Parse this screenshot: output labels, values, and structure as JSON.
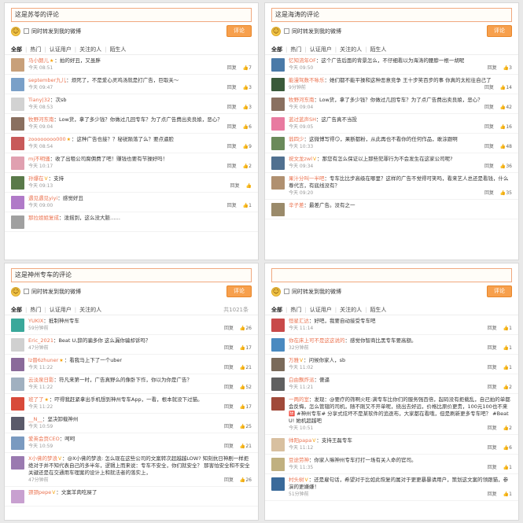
{
  "panels": [
    {
      "input": "这是苏苓的评论",
      "also_forward": "同时转发到我的微博",
      "submit": "评论",
      "tabs": [
        "全部",
        "热门",
        "认证用户",
        "关注的人",
        "陌生人"
      ],
      "total": "",
      "comments": [
        {
          "user": "马小朗儿",
          "badge": "★",
          "text": "拍的好丑，又虽胖",
          "time": "今天 08:51",
          "reply": "回复",
          "likes": "7",
          "avatar": "#c8a07a"
        },
        {
          "user": "september九儿",
          "badge": "",
          "text": "烦死了，不是爱心灵鸡汤就是打广告，巨取关～",
          "time": "今天 09:47",
          "reply": "回复",
          "likes": "3",
          "avatar": "#7aa0c8"
        },
        {
          "user": "Tiany|32",
          "badge": "",
          "text": "次sb",
          "time": "今天 08:53",
          "reply": "回复",
          "likes": "3",
          "avatar": "#d2d2d2"
        },
        {
          "user": "牧野河东南",
          "badge": "",
          "text": "Low货，拿了多少钱？你做过几回专车？为了点广告费出卖良娘，恶心？",
          "time": "今天 09:04",
          "reply": "回复",
          "likes": "6",
          "avatar": "#8a7060"
        },
        {
          "user": "zoooooooo000",
          "badge": "★",
          "text": "这种广告也接？？秘锐陨落了么？要点逼脸",
          "time": "今天 08:54",
          "reply": "回复",
          "likes": "9",
          "avatar": "#c85a5a"
        },
        {
          "user": "mj不明骚",
          "badge": "",
          "text": "收了出租公司腐佣费了吧！赚钱也要有节操好吗！",
          "time": "今天 10:17",
          "reply": "回复",
          "likes": "2",
          "avatar": "#e0a0b0"
        },
        {
          "user": "孙爆在",
          "badge": "V",
          "text": "支持",
          "time": "今天 09:13",
          "reply": "回复",
          "likes": "",
          "avatar": "#5a7a4a"
        },
        {
          "user": "遇见遇见yiyi",
          "badge": "",
          "text": "感觉好丑",
          "time": "今天 09:00",
          "reply": "回复",
          "likes": "1",
          "avatar": "#b07ac8"
        },
        {
          "user": "那拉姐姐复成",
          "badge": "",
          "text": "泼摇到，这么没大脓……",
          "time": "",
          "reply": "",
          "likes": "",
          "avatar": "#a0a0a0"
        }
      ]
    },
    {
      "input": "这是海涛的评论",
      "also_forward": "同时转发到我的微博",
      "submit": "评论",
      "tabs": [
        "全部",
        "热门",
        "认证用户",
        "关注的人",
        "陌生人"
      ],
      "total": "",
      "comments": [
        {
          "user": "忆知流年OF",
          "badge": "",
          "text": "这个广告后面的背景怎么，不仔细看以为海涛的腰脖一根一胡呢",
          "time": "今天 09:50",
          "reply": "回复",
          "likes": "3",
          "avatar": "#4a7aa8"
        },
        {
          "user": "能漫驾数不咏乐",
          "badge": "",
          "text": "她们都不能平操和这种恶意竞争 王十步笑百步的事 你真的太松往自己了",
          "time": "9分钟前",
          "reply": "回复",
          "likes": "14",
          "avatar": "#3a5a3a"
        },
        {
          "user": "牧野河东南",
          "badge": "",
          "text": "Low货，拿了多少钱？你做过几回专车？为了点广告费出卖良娘，恶心？",
          "time": "今天 09:04",
          "reply": "回复",
          "likes": "42",
          "avatar": "#8a7060"
        },
        {
          "user": "蓝过蓝声SH",
          "badge": "",
          "text": "这广告真不当投",
          "time": "今天 09:05",
          "reply": "回复",
          "likes": "16",
          "avatar": "#e87aa0"
        },
        {
          "user": "翁四少",
          "badge": "",
          "text": "这微博写得😏，果断都粉，从此再也不看你的任何作品，敢涂跟啊",
          "time": "今天 10:33",
          "reply": "回复",
          "likes": "48",
          "avatar": "#6a8a5a"
        },
        {
          "user": "祝文龙zwl",
          "badge": "V",
          "text": "那您有怎么保证以上那些犯罪行为不会发生在这家公司呢?",
          "time": "今天 09:34",
          "reply": "回复",
          "likes": "36",
          "avatar": "#507090"
        },
        {
          "user": "果汁分叫一半吧",
          "badge": "",
          "text": "专车比比步高级在哪里？这样的广告不觉得可笑吗，看来艺人总还是看钱，什么尊代言，有底线没有？",
          "time": "今天 09:20",
          "reply": "回复",
          "likes": "35",
          "avatar": "#b09070"
        },
        {
          "user": "辛子差",
          "badge": "",
          "text": "最差广告。没有之一",
          "time": "",
          "reply": "",
          "likes": "",
          "avatar": "#9a8a6a"
        }
      ]
    },
    {
      "input": "这是神州专车的评论",
      "also_forward": "同时转发到我的微博",
      "submit": "评论",
      "tabs": [
        "全部",
        "热门",
        "认证用户",
        "关注的人"
      ],
      "total": "共1021条",
      "comments": [
        {
          "user": "YUKIX",
          "badge": "",
          "text": "抵制神州专车",
          "time": "59分钟前",
          "reply": "回复",
          "likes": "26",
          "avatar": "#3aa89a"
        },
        {
          "user": "Eric_2021",
          "badge": "",
          "text": "Beat U,辞的骗多你 这么漏你骗却诉吗？",
          "time": "47分钟前",
          "reply": "回复",
          "likes": "17",
          "avatar": "#d0d0d0"
        },
        {
          "user": "lz晋6zhuner",
          "badge": "★",
          "text": "看我马上下了一个uber",
          "time": "今天 11:22",
          "reply": "回复",
          "likes": "21",
          "avatar": "#8a6a9a"
        },
        {
          "user": "云淡泉日影",
          "badge": "",
          "text": "符凡来第一时，广告真野么的像卧下作，你以为你是广告？",
          "time": "今天 11:22",
          "reply": "回复",
          "likes": "52",
          "avatar": "#a0b0c0"
        },
        {
          "user": "班了了",
          "badge": "★",
          "text": "吓得我赶紧拿出手机想到神州专车App，一看，根本就没下过猫。",
          "time": "今天 11:22",
          "reply": "回复",
          "likes": "17",
          "avatar": "#d84a3a"
        },
        {
          "user": "__N__",
          "badge": "",
          "text": "坚决卸载神州",
          "time": "今天 10:59",
          "reply": "回复",
          "likes": "25",
          "avatar": "#5a5a6a"
        },
        {
          "user": "爱英会页CEO",
          "badge": "",
          "text": "呵呵",
          "time": "今天 10:59",
          "reply": "回复",
          "likes": "21",
          "avatar": "#7a9ac0"
        },
        {
          "user": "X小佛的梦浪",
          "badge": "V",
          "text": "@X小佛的梦浪: 怎么现在这些公司的文案转次超越越LOW? 知刻抗日神剧一样拒绝对于并不知代表自己的多半年，逻辑上而来说：专车不安全，你们就安全？ 那害怕安全和不安全关键还是在交通用车理案的设计上和就法者的落实上，",
          "time": "47分钟前",
          "reply": "回复",
          "likes": "26",
          "avatar": "#9a7ab0"
        },
        {
          "user": "颈颈pepe",
          "badge": "V",
          "text": "文案羊肉吃屎了",
          "time": "",
          "reply": "",
          "likes": "",
          "avatar": "#c8a0d0"
        }
      ]
    },
    {
      "input": "",
      "also_forward": "同时转发到我的微博",
      "submit": "评论",
      "tabs": [
        "全部",
        "热门",
        "认证用户",
        "关注的人",
        "陌生人"
      ],
      "total": "",
      "comments": [
        {
          "user": "恒星汇达",
          "badge": "",
          "text": "好吧，我要自动接受专车吧",
          "time": "今天 11:14",
          "reply": "回复",
          "likes": "1",
          "avatar": "#c84a4a"
        },
        {
          "user": "你在床上可不是这这说的",
          "badge": "",
          "text": "感觉你智商比黑专车要高额。",
          "time": "32分钟前",
          "reply": "回复",
          "likes": "1",
          "avatar": "#4a8ac0"
        },
        {
          "user": "万雅",
          "badge": "V",
          "text": "问候你家人，sb",
          "time": "今天 11:02",
          "reply": "回复",
          "likes": "1",
          "avatar": "#7a6a5a"
        },
        {
          "user": "白由飘炸派",
          "badge": "",
          "text": "傻逼",
          "time": "今天 11:21",
          "reply": "回复",
          "likes": "2",
          "avatar": "#606060"
        },
        {
          "user": "一两的室",
          "badge": "",
          "text": "发现：@要疗的筛啊火旺:满专车比你们的服务强百倍，起码没有拒载乱，自己拍的单都会反悔，怎么管辖的司机，随不刚又不开单呢，绕出去好远，价格比原价更贵，100元100也不来🈲 #神州专车# 分享式炫坏不是某软件的追逐布，大家都在看哦，但是刷新更多专车吧？ #BeatU! 她机超越吧",
          "time": "今天 10:51",
          "reply": "回复",
          "likes": "2",
          "avatar": "#a04a3a"
        },
        {
          "user": "帅阳papa",
          "badge": "V",
          "text": "支持王磊专车",
          "time": "今天 11:12",
          "reply": "回复",
          "likes": "6",
          "avatar": "#d8c0a0"
        },
        {
          "user": "豆途劳神",
          "badge": "",
          "text": "你家人嘛神州专车打打一场有关人命的官司。",
          "time": "今天 11:35",
          "reply": "回复",
          "likes": "1",
          "avatar": "#c0b080"
        },
        {
          "user": "村头树",
          "badge": "V",
          "text": "还是雇句话，希望对于比如此恢复的属对于更更暴暴请用户，策划这文案的领跟猫，参演的更嫌嫌！",
          "time": "51分钟前",
          "reply": "回复",
          "likes": "1",
          "avatar": "#3a6a9a"
        }
      ]
    }
  ]
}
